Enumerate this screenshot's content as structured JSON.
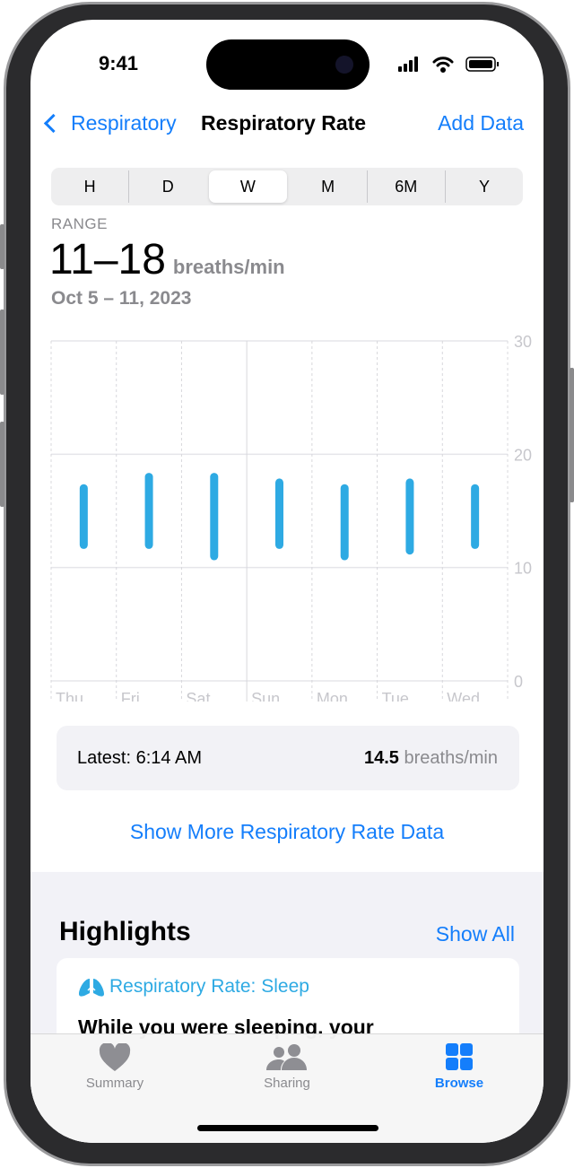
{
  "status": {
    "time": "9:41"
  },
  "nav": {
    "back_label": "Respiratory",
    "title": "Respiratory Rate",
    "action_label": "Add Data"
  },
  "segments": [
    "H",
    "D",
    "W",
    "M",
    "6M",
    "Y"
  ],
  "selected_segment": "W",
  "summary": {
    "label": "RANGE",
    "value": "11–18",
    "unit": "breaths/min",
    "date": "Oct 5 – 11, 2023"
  },
  "chart_data": {
    "type": "range-bar",
    "categories": [
      "Thu",
      "Fri",
      "Sat",
      "Sun",
      "Mon",
      "Tue",
      "Wed"
    ],
    "ranges": [
      [
        12,
        17
      ],
      [
        12,
        18
      ],
      [
        11,
        18
      ],
      [
        12,
        17.5
      ],
      [
        11,
        17
      ],
      [
        11.5,
        17.5
      ],
      [
        12,
        17
      ]
    ],
    "yticks": [
      "0",
      "10",
      "20",
      "30"
    ],
    "ylim": [
      0,
      30
    ],
    "color": "#2eaae3",
    "grid": true
  },
  "latest": {
    "label": "Latest: 6:14 AM",
    "value": "14.5",
    "unit": "breaths/min"
  },
  "show_more": "Show More Respiratory Rate Data",
  "highlights": {
    "title": "Highlights",
    "show_all": "Show All",
    "card_title": "Respiratory Rate: Sleep",
    "card_text": "While you were sleeping, your"
  },
  "tabs": [
    {
      "label": "Summary",
      "icon": "heart-icon"
    },
    {
      "label": "Sharing",
      "icon": "people-icon"
    },
    {
      "label": "Browse",
      "icon": "grid-icon",
      "active": true
    }
  ],
  "colors": {
    "accent": "#147efb",
    "respiratory": "#2eaae3"
  }
}
